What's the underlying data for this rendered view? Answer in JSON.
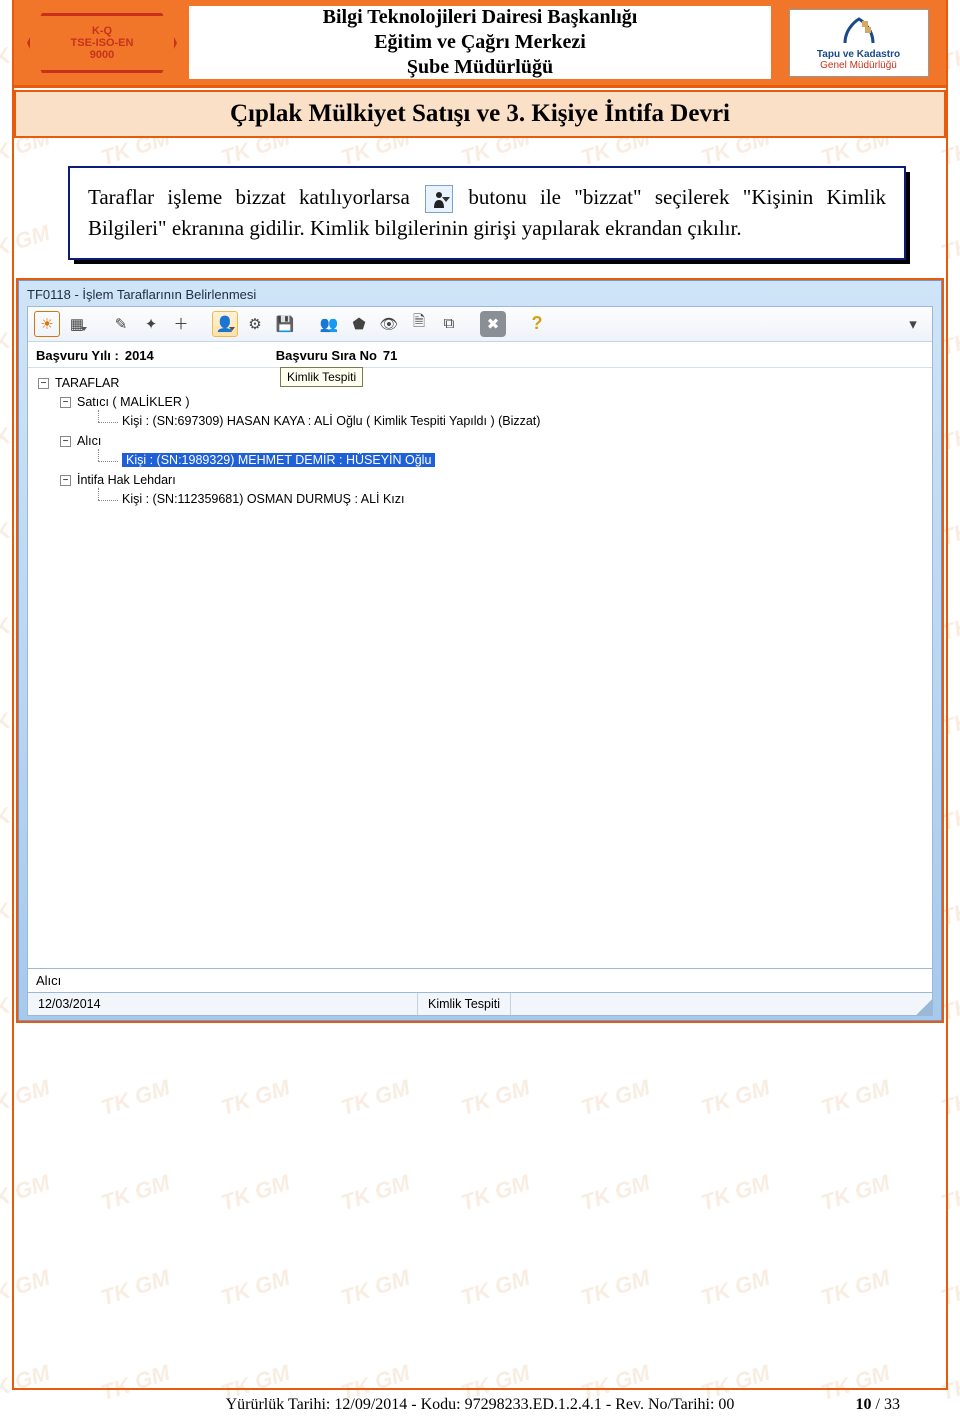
{
  "header": {
    "line1": "Bilgi Teknolojileri Dairesi Başkanlığı",
    "line2": "Eğitim ve Çağrı Merkezi",
    "line3": "Şube Müdürlüğü",
    "quality_seal_line1": "K-Q",
    "quality_seal_line2": "TSE-ISO-EN",
    "quality_seal_line3": "9000",
    "tkgm_line1": "Tapu ve Kadastro",
    "tkgm_line2": "Genel Müdürlüğü"
  },
  "subheader": "Çıplak Mülkiyet Satışı ve 3. Kişiye İntifa Devri",
  "instruction": {
    "part1": "Taraflar işleme bizzat katılıyorlarsa ",
    "icon_name": "person-dropdown-icon",
    "icon_glyph": "◉",
    "part2": " butonu ile \"bizzat\" seçilerek \"Kişinin Kimlik Bilgileri\" ekranına gidilir. Kimlik bilgilerinin girişi yapılarak ekrandan çıkılır."
  },
  "window": {
    "title": "TF0118 - İşlem Taraflarının Belirlenmesi",
    "tooltip": "Kimlik Tespiti",
    "meta": {
      "year_label": "Başvuru Yılı :",
      "year_value": "2014",
      "seq_label": "Başvuru Sıra No",
      "seq_value": "71"
    },
    "tree": {
      "root": "TARAFLAR",
      "groups": [
        {
          "label": "Satıcı ( MALİKLER )",
          "items": [
            "Kişi : (SN:697309) HASAN KAYA : ALİ Oğlu  ( Kimlik Tespiti Yapıldı ) (Bizzat)"
          ]
        },
        {
          "label": "Alıcı",
          "items": [
            "Kişi : (SN:1989329) MEHMET DEMİR : HÜSEYİN Oğlu"
          ],
          "selected_index": 0
        },
        {
          "label": "İntifa Hak Lehdarı",
          "items": [
            "Kişi : (SN:112359681) OSMAN DURMUŞ : ALİ Kızı"
          ]
        }
      ]
    },
    "bottom_field": "Alıcı",
    "status": {
      "date": "12/03/2014",
      "mode": "Kimlik Tespiti"
    },
    "toolbar_icons": [
      {
        "name": "sun-icon",
        "glyph": "☀"
      },
      {
        "name": "calendar-icon",
        "glyph": "▦",
        "drop": true
      },
      {
        "name": "wand-icon",
        "glyph": "✎"
      },
      {
        "name": "bulb-icon",
        "glyph": "✦"
      },
      {
        "name": "plus-icon",
        "glyph": "＋"
      },
      {
        "name": "person-icon",
        "glyph": "👤",
        "drop": true,
        "highlight": true
      },
      {
        "name": "gear-icon",
        "glyph": "⚙"
      },
      {
        "name": "save-icon",
        "glyph": "💾"
      },
      {
        "name": "users-icon",
        "glyph": "👥"
      },
      {
        "name": "shield-icon",
        "glyph": "⬟"
      },
      {
        "name": "eye-icon",
        "glyph": "👁"
      },
      {
        "name": "doc-icon",
        "glyph": "🗎"
      },
      {
        "name": "sheet-icon",
        "glyph": "⧉"
      },
      {
        "name": "close-icon",
        "glyph": "✖"
      },
      {
        "name": "help-icon",
        "glyph": "?"
      }
    ]
  },
  "footer": {
    "left": "Yürürlük Tarihi: 12/09/2014  -  Kodu:  97298233.ED.1.2.4.1  -  Rev. No/Tarihi: 00",
    "page_current": "10",
    "page_sep": " / ",
    "page_total": "33"
  },
  "watermark_text": "TK GM"
}
